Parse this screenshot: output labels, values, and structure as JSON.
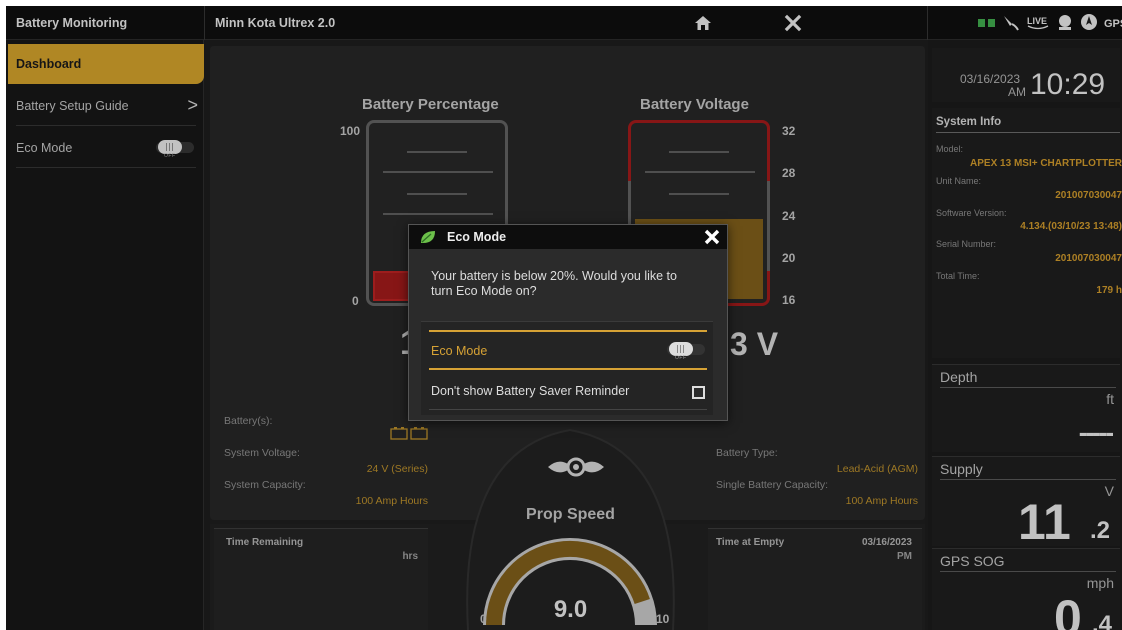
{
  "topbar": {
    "app_title": "Battery Monitoring",
    "device_title": "Minn Kota Ultrex 2.0",
    "live_label": "LIVE",
    "gps_label": "GPS"
  },
  "sidebar": {
    "items": [
      {
        "label": "Dashboard"
      },
      {
        "label": "Battery Setup Guide",
        "chevron": ">"
      },
      {
        "label": "Eco Mode",
        "toggle_state": "OFF"
      }
    ]
  },
  "dashboard": {
    "battery_percentage": {
      "title": "Battery Percentage",
      "ticks": [
        "100",
        "0"
      ],
      "value_partial": "1"
    },
    "battery_voltage": {
      "title": "Battery Voltage",
      "ticks": [
        "32",
        "28",
        "24",
        "20",
        "16"
      ],
      "value_partial": "3 V"
    },
    "left_info": {
      "batteries_label": "Battery(s):",
      "system_voltage_label": "System Voltage:",
      "system_voltage_value": "24 V (Series)",
      "system_capacity_label": "System Capacity:",
      "system_capacity_value": "100 Amp Hours"
    },
    "right_info": {
      "battery_type_label": "Battery Type:",
      "battery_type_value": "Lead-Acid (AGM)",
      "single_capacity_label": "Single Battery Capacity:",
      "single_capacity_value": "100 Amp Hours"
    },
    "time_remaining": {
      "label": "Time Remaining",
      "unit": "hrs"
    },
    "time_at_empty": {
      "label": "Time at Empty",
      "date": "03/16/2023",
      "ampm": "PM"
    },
    "prop_speed": {
      "title": "Prop Speed",
      "value": "9.0",
      "min": "0",
      "max": "10",
      "fraction": 0.9
    }
  },
  "right_panel": {
    "date": "03/16/2023",
    "ampm": "AM",
    "time": "10:29",
    "system_info": {
      "title": "System Info",
      "model_label": "Model:",
      "model_value": "APEX 13 MSI+ CHARTPLOTTER",
      "unit_name_label": "Unit Name:",
      "unit_name_value": "201007030047",
      "software_label": "Software Version:",
      "software_value": "4.134.(03/10/23 13:48)",
      "serial_label": "Serial Number:",
      "serial_value": "201007030047",
      "total_time_label": "Total Time:",
      "total_time_value": "179 h"
    },
    "depth": {
      "title": "Depth",
      "unit": "ft",
      "value": "-----"
    },
    "supply": {
      "title": "Supply",
      "unit": "V",
      "value_int": "11",
      "value_dec": ".2"
    },
    "gps_sog": {
      "title": "GPS SOG",
      "unit": "mph",
      "value_int": "0",
      "value_dec": ".4"
    }
  },
  "dialog": {
    "title": "Eco Mode",
    "message": "Your battery is below 20%. Would you like to turn Eco Mode on?",
    "eco_option_label": "Eco Mode",
    "eco_toggle_state": "OFF",
    "reminder_label": "Don't show Battery Saver Reminder",
    "reminder_checked": false
  },
  "colors": {
    "accent": "#c99a2a",
    "value_text": "#b3892a",
    "warning_red": "#9a1a1a",
    "gauge_fill": "#7a5a1a"
  }
}
